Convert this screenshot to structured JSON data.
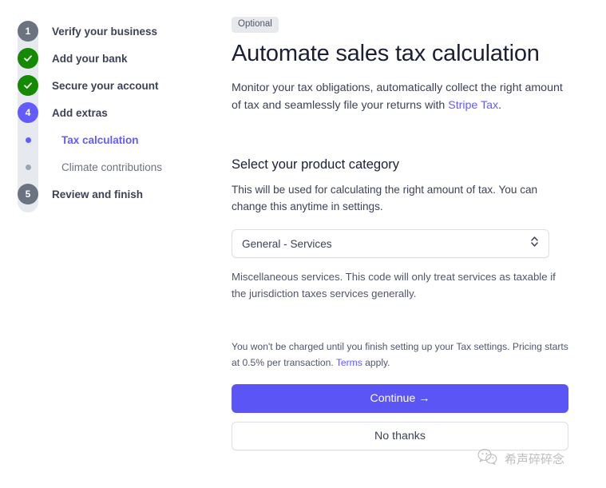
{
  "sidebar": {
    "steps": [
      {
        "marker": "1",
        "type": "number-gray",
        "label": "Verify your business"
      },
      {
        "marker": "check",
        "type": "done",
        "label": "Add your bank"
      },
      {
        "marker": "check",
        "type": "done",
        "label": "Secure your account"
      },
      {
        "marker": "4",
        "type": "number-active",
        "label": "Add extras"
      }
    ],
    "substeps": [
      {
        "label": "Tax calculation",
        "state": "active"
      },
      {
        "label": "Climate contributions",
        "state": "inactive"
      }
    ],
    "final_step": {
      "marker": "5",
      "type": "number-gray",
      "label": "Review and finish"
    }
  },
  "main": {
    "badge": "Optional",
    "title": "Automate sales tax calculation",
    "lede_before": "Monitor your tax obligations, automatically collect the right amount of tax and seamlessly file your returns with ",
    "lede_link": "Stripe Tax",
    "lede_after": ".",
    "section_title": "Select your product category",
    "section_desc": "This will be used for calculating the right amount of tax. You can change this anytime in settings.",
    "select_value": "General - Services",
    "select_icon": "chevron-up-down-icon",
    "help_text": "Miscellaneous services. This code will only treat services as taxable if the jurisdiction taxes services generally.",
    "fineprint_before": "You won't be charged until you finish setting up your Tax settings. Pricing starts at 0.5% per transaction. ",
    "fineprint_link": "Terms",
    "fineprint_after": " apply.",
    "continue_label": "Continue  →",
    "no_thanks_label": "No thanks"
  },
  "watermark": {
    "icon": "wechat-icon",
    "text": "希声碎碎念"
  },
  "colors": {
    "accent": "#635bff",
    "button": "#5b55f5",
    "success": "#138a00",
    "gray_marker": "#6b7280",
    "rail": "#e6eaef",
    "badge_bg": "#e7e9ec",
    "text_dark": "#1a1f36",
    "text_body": "#3c4257",
    "text_muted": "#6b7280",
    "border": "#dcdfe4"
  }
}
